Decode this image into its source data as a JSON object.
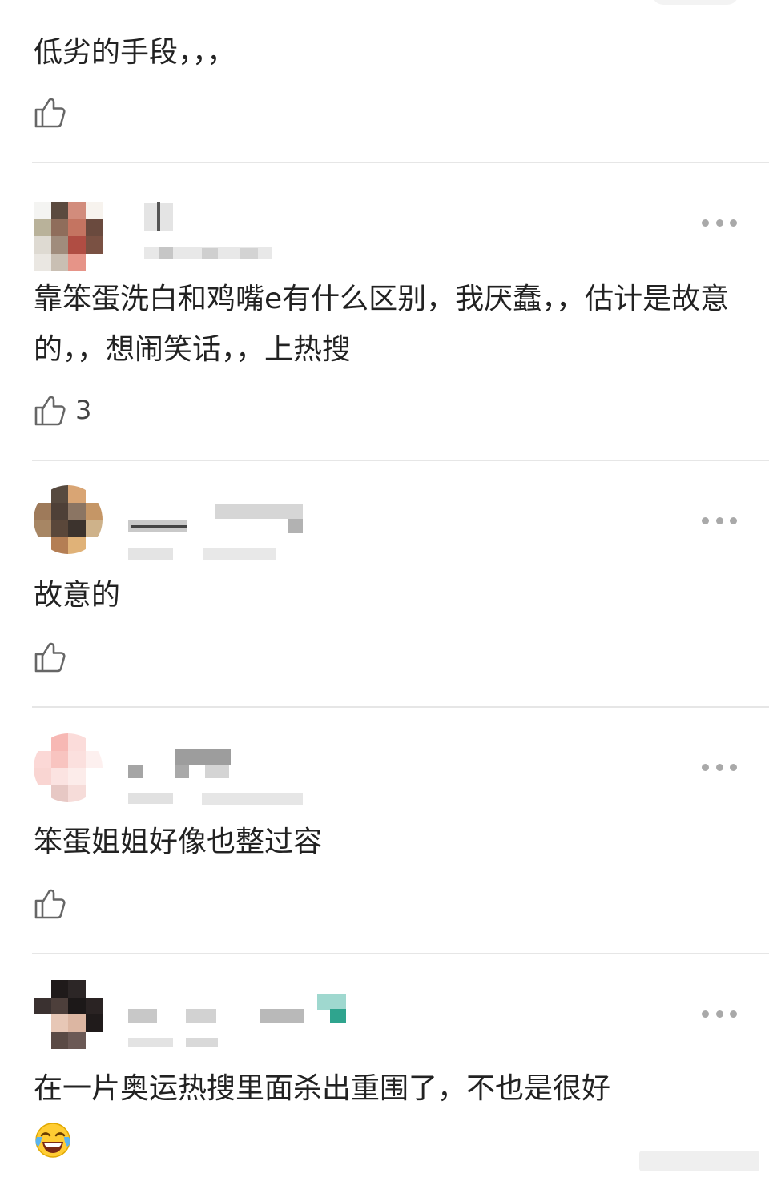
{
  "colors": {
    "text": "#222222",
    "divider": "#e6e6e6",
    "icon": "#666666",
    "more_dots": "#a9a9a9"
  },
  "comments": [
    {
      "text": "低劣的手段，，，",
      "likes": "",
      "icon": "thumbs-up-icon"
    },
    {
      "text": "靠笨蛋洗白和鸡嘴e有什么区别，我厌蠢，，估计是故意的，，想闹笑话，，上热搜",
      "likes": "3",
      "icon": "thumbs-up-icon"
    },
    {
      "text": "故意的",
      "likes": "",
      "icon": "thumbs-up-icon"
    },
    {
      "text": "笨蛋姐姐好像也整过容",
      "likes": "",
      "icon": "thumbs-up-icon"
    },
    {
      "text": "在一片奥运热搜里面杀出重围了，不也是很好",
      "emoji": "laughing-tears-emoji",
      "likes": "",
      "icon": "thumbs-up-icon"
    }
  ]
}
